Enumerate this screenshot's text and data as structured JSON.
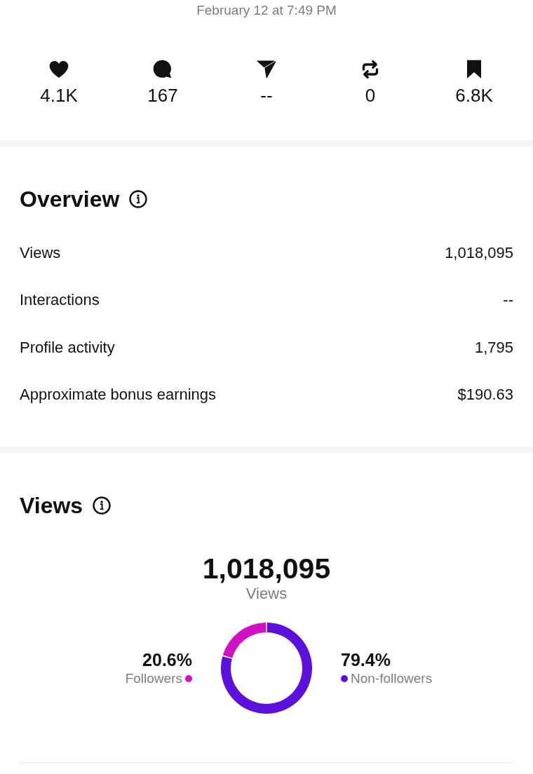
{
  "post_date": "February 12 at 7:49 PM",
  "stats": [
    {
      "kind": "like",
      "value": "4.1K"
    },
    {
      "kind": "comment",
      "value": "167"
    },
    {
      "kind": "share",
      "value": "--"
    },
    {
      "kind": "repost",
      "value": "0"
    },
    {
      "kind": "save",
      "value": "6.8K"
    }
  ],
  "overview": {
    "title": "Overview",
    "rows": [
      {
        "label": "Views",
        "value": "1,018,095"
      },
      {
        "label": "Interactions",
        "value": "--"
      },
      {
        "label": "Profile activity",
        "value": "1,795"
      },
      {
        "label": "Approximate bonus earnings",
        "value": "$190.63"
      }
    ]
  },
  "views": {
    "title": "Views",
    "total": "1,018,095",
    "chart_data": {
      "type": "donut",
      "categories": [
        "Followers",
        "Non-followers"
      ],
      "series": [
        {
          "name": "Views",
          "values": [
            20.6,
            79.4
          ]
        }
      ],
      "value_labels": [
        "20.6%",
        "79.4%"
      ]
    },
    "legend": [
      {
        "color": "#d012c4"
      },
      {
        "color": "#5b10dc"
      }
    ]
  }
}
